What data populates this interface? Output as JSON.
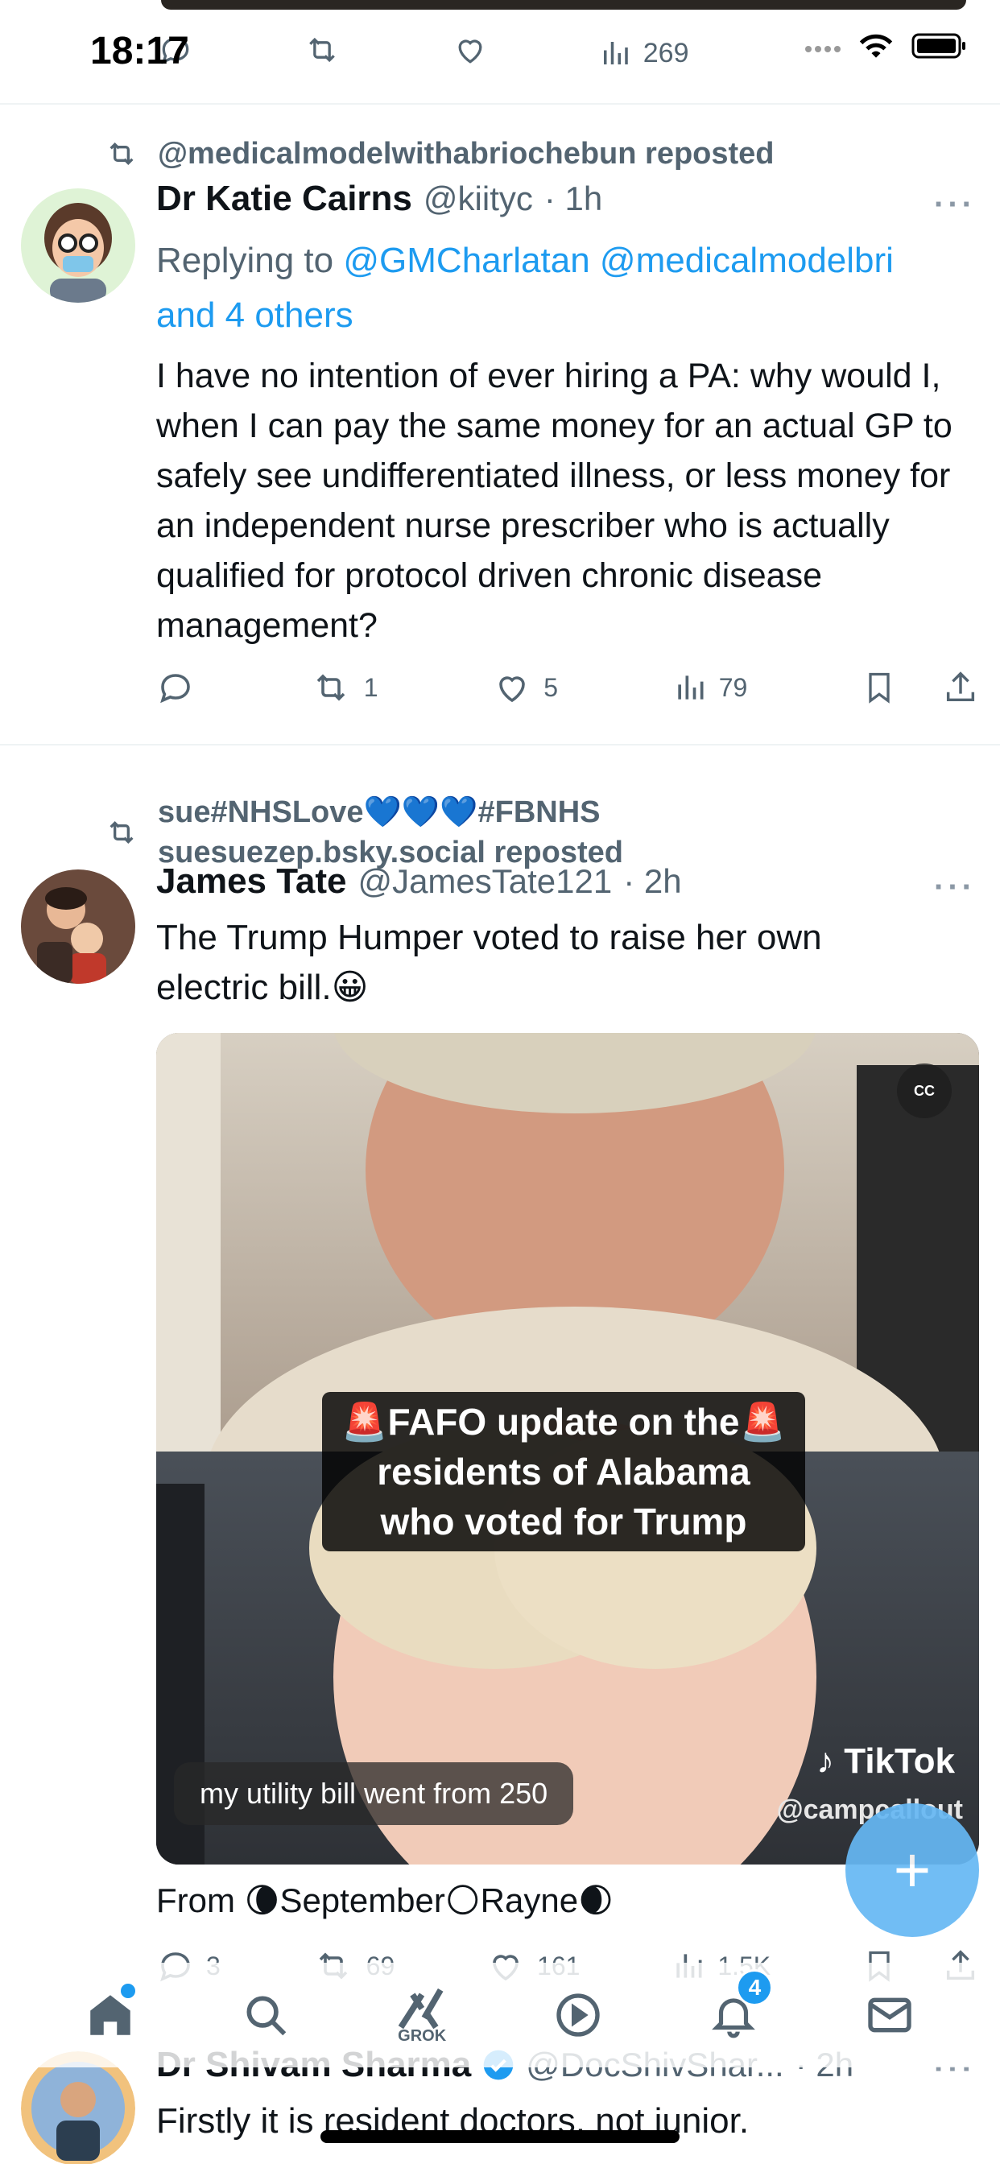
{
  "status_bar": {
    "time": "18:17"
  },
  "top_tweet": {
    "views": "269"
  },
  "tweet1": {
    "repost_by": "@medicalmodelwithabriochebun reposted",
    "name": "Dr Katie Cairns",
    "handle": "@kiityc",
    "time": "· 1h",
    "replying_to_prefix": "Replying to",
    "replying_to_users": "@GMCharlatan @medicalmodelbri",
    "replying_to_more": "and 4 others",
    "text": "I have no intention of ever hiring a PA: why would I, when I can pay the same money for an actual GP to safely see undifferentiated illness, or less money for an independent nurse prescriber who is actually qualified  for protocol driven chronic disease management?",
    "retweets": "1",
    "likes": "5",
    "views": "79"
  },
  "tweet2": {
    "repost_line1": "sue#NHSLove💙💙💙#FBNHS",
    "repost_line2": "suesuezep.bsky.social reposted",
    "name": "James Tate",
    "handle": "@JamesTate121",
    "time": "· 2h",
    "text": "The Trump Humper voted to raise her own electric bill.😀",
    "media": {
      "caption": "🚨FAFO update on the🚨 residents of Alabama who voted for Trump",
      "subtitle": "my utility bill went from 250",
      "watermark": "TikTok",
      "watermark_handle": "@campcallout",
      "cc_label": "CC"
    },
    "from_line": "From 🌘September🌕Rayne🌒",
    "replies": "3",
    "retweets": "69",
    "likes": "161",
    "views": "1.5K"
  },
  "tweet3": {
    "name": "Dr Shivam Sharma",
    "handle": "@DocShivShar...",
    "time": "· 2h",
    "text": "Firstly it is resident doctors, not junior."
  },
  "tabbar": {
    "grok_label": "GROK",
    "notifications_count": "4"
  },
  "colors": {
    "accent": "#1d9bf0",
    "muted": "#536471"
  },
  "icons": [
    "reply-icon",
    "retweet-icon",
    "like-icon",
    "views-icon",
    "bookmark-icon",
    "share-icon",
    "home-icon",
    "search-icon",
    "grok-icon",
    "video-icon",
    "bell-icon",
    "mail-icon",
    "compose-icon"
  ]
}
